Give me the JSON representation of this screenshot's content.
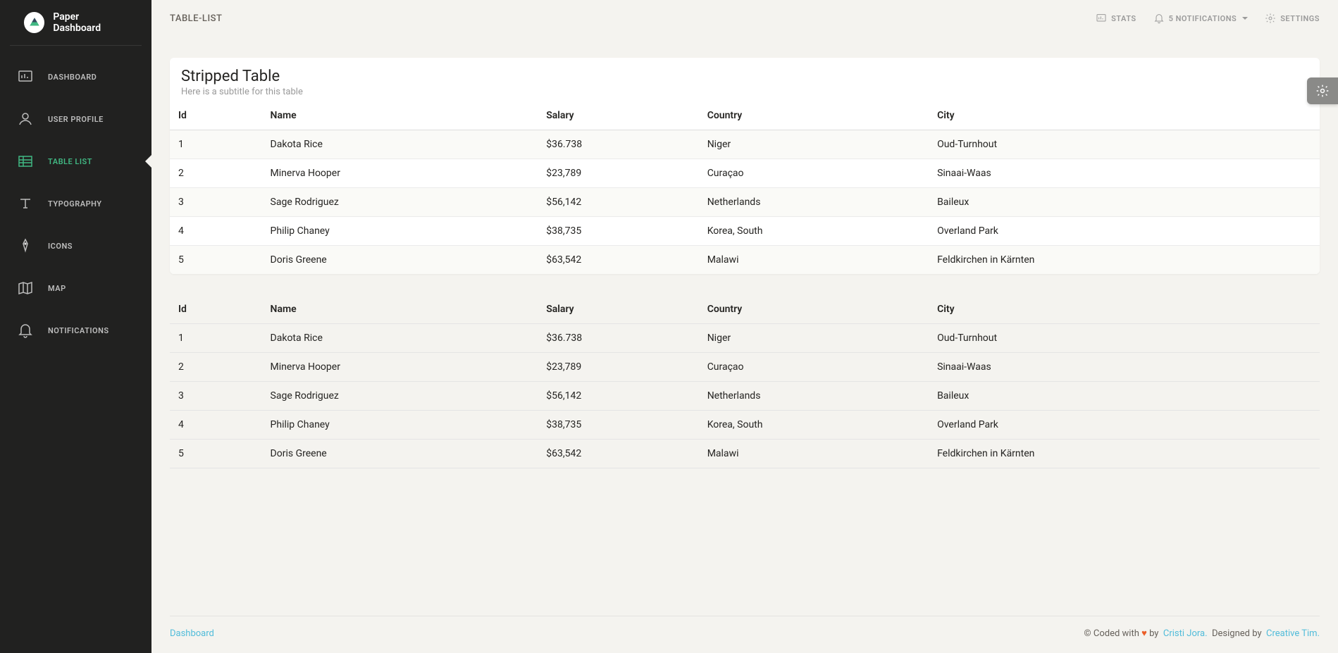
{
  "brand": "Paper Dashboard",
  "page_title": "TABLE-LIST",
  "topbar": {
    "stats": "STATS",
    "notifications": "5 NOTIFICATIONS",
    "settings": "SETTINGS"
  },
  "sidebar": {
    "items": [
      {
        "label": "DASHBOARD"
      },
      {
        "label": "USER PROFILE"
      },
      {
        "label": "TABLE LIST"
      },
      {
        "label": "TYPOGRAPHY"
      },
      {
        "label": "ICONS"
      },
      {
        "label": "MAP"
      },
      {
        "label": "NOTIFICATIONS"
      }
    ]
  },
  "card1": {
    "title": "Stripped Table",
    "subtitle": "Here is a subtitle for this table"
  },
  "columns": {
    "c0": "Id",
    "c1": "Name",
    "c2": "Salary",
    "c3": "Country",
    "c4": "City"
  },
  "rows": [
    {
      "id": "1",
      "name": "Dakota Rice",
      "salary": "$36.738",
      "country": "Niger",
      "city": "Oud-Turnhout"
    },
    {
      "id": "2",
      "name": "Minerva Hooper",
      "salary": "$23,789",
      "country": "Curaçao",
      "city": "Sinaai-Waas"
    },
    {
      "id": "3",
      "name": "Sage Rodriguez",
      "salary": "$56,142",
      "country": "Netherlands",
      "city": "Baileux"
    },
    {
      "id": "4",
      "name": "Philip Chaney",
      "salary": "$38,735",
      "country": "Korea, South",
      "city": "Overland Park"
    },
    {
      "id": "5",
      "name": "Doris Greene",
      "salary": "$63,542",
      "country": "Malawi",
      "city": "Feldkirchen in Kärnten"
    }
  ],
  "footer": {
    "left": "Dashboard",
    "coded_with": "© Coded with",
    "by": "by",
    "author": "Cristi Jora.",
    "designed_by": "Designed by",
    "designer": "Creative Tim."
  }
}
